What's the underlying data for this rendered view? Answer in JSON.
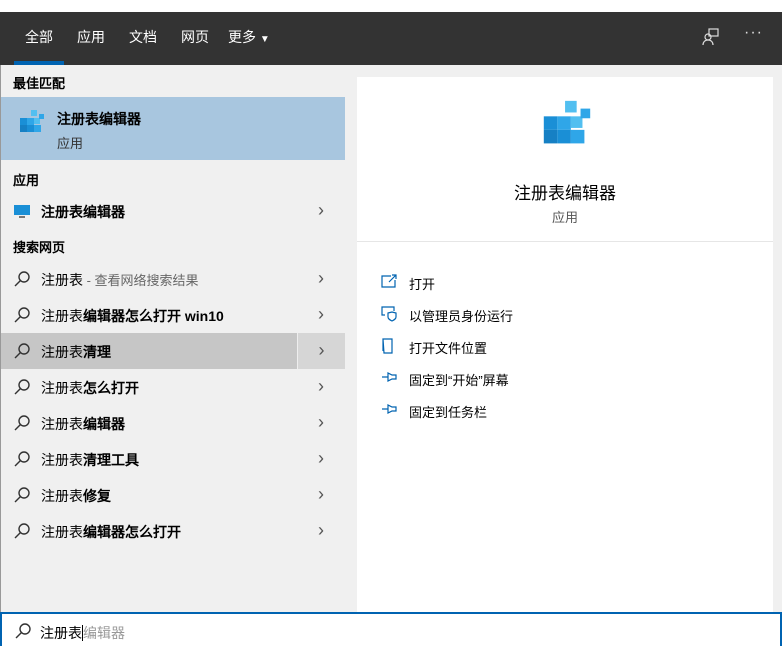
{
  "tabs": [
    {
      "label": "全部",
      "active": true
    },
    {
      "label": "应用"
    },
    {
      "label": "文档"
    },
    {
      "label": "网页"
    },
    {
      "label": "更多"
    }
  ],
  "header_icons": [
    "feedback-icon",
    "more-icon"
  ],
  "more_glyph": "···",
  "sections": {
    "best": "最佳匹配",
    "apps": "应用",
    "web": "搜索网页"
  },
  "best_match": {
    "title": "注册表编辑器",
    "subtitle": "应用"
  },
  "app_item": {
    "label": "注册表编辑器"
  },
  "web_items": [
    {
      "q": "注册表",
      "rest": "",
      "suffix": " - 查看网络搜索结果"
    },
    {
      "q": "注册表",
      "rest": "编辑器怎么打开 win10",
      "suffix": ""
    },
    {
      "q": "注册表",
      "rest": "清理",
      "suffix": ""
    },
    {
      "q": "注册表",
      "rest": "怎么打开",
      "suffix": ""
    },
    {
      "q": "注册表",
      "rest": "编辑器",
      "suffix": ""
    },
    {
      "q": "注册表",
      "rest": "清理工具",
      "suffix": ""
    },
    {
      "q": "注册表",
      "rest": "修复",
      "suffix": ""
    },
    {
      "q": "注册表",
      "rest": "编辑器怎么打开",
      "suffix": ""
    }
  ],
  "detail": {
    "title": "注册表编辑器",
    "subtitle": "应用",
    "actions": [
      "打开",
      "以管理员身份运行",
      "打开文件位置",
      "固定到“开始”屏幕",
      "固定到任务栏"
    ]
  },
  "search": {
    "typed": "注册表",
    "suggestion": "编辑器"
  },
  "colors": {
    "accent": "#0063b1",
    "header": "#333333",
    "selected": "#a8c6df"
  }
}
